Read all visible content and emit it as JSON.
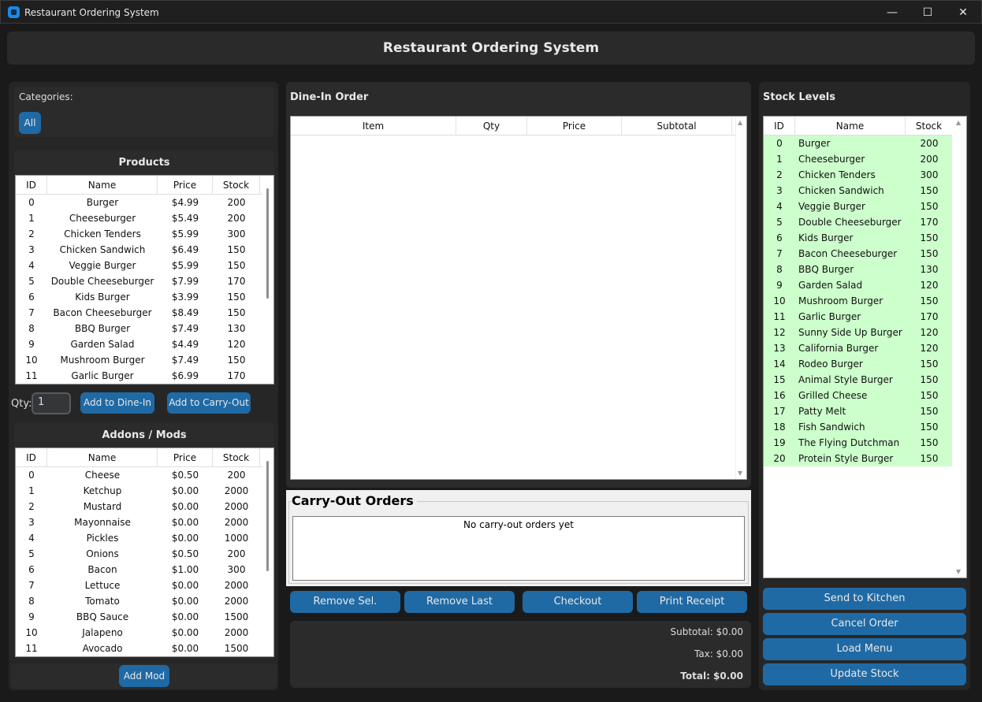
{
  "window": {
    "title": "Restaurant Ordering System",
    "minimize": "—",
    "maximize": "☐",
    "close": "✕"
  },
  "header": {
    "title": "Restaurant Ordering System"
  },
  "categories": {
    "label": "Categories:",
    "buttons": [
      "All"
    ]
  },
  "products": {
    "title": "Products",
    "columns": [
      "ID",
      "Name",
      "Price",
      "Stock"
    ],
    "rows": [
      [
        "0",
        "Burger",
        "$4.99",
        "200"
      ],
      [
        "1",
        "Cheeseburger",
        "$5.49",
        "200"
      ],
      [
        "2",
        "Chicken Tenders",
        "$5.99",
        "300"
      ],
      [
        "3",
        "Chicken Sandwich",
        "$6.49",
        "150"
      ],
      [
        "4",
        "Veggie Burger",
        "$5.99",
        "150"
      ],
      [
        "5",
        "Double Cheeseburger",
        "$7.99",
        "170"
      ],
      [
        "6",
        "Kids Burger",
        "$3.99",
        "150"
      ],
      [
        "7",
        "Bacon Cheeseburger",
        "$8.49",
        "150"
      ],
      [
        "8",
        "BBQ Burger",
        "$7.49",
        "130"
      ],
      [
        "9",
        "Garden Salad",
        "$4.49",
        "120"
      ],
      [
        "10",
        "Mushroom Burger",
        "$7.49",
        "150"
      ],
      [
        "11",
        "Garlic Burger",
        "$6.99",
        "170"
      ]
    ]
  },
  "qty": {
    "label": "Qty:",
    "value": "1"
  },
  "actions": {
    "add_dine_in": "Add to Dine-In",
    "add_carry_out": "Add to Carry-Out"
  },
  "addons": {
    "title": "Addons / Mods",
    "columns": [
      "ID",
      "Name",
      "Price",
      "Stock"
    ],
    "rows": [
      [
        "0",
        "Cheese",
        "$0.50",
        "200"
      ],
      [
        "1",
        "Ketchup",
        "$0.00",
        "2000"
      ],
      [
        "2",
        "Mustard",
        "$0.00",
        "2000"
      ],
      [
        "3",
        "Mayonnaise",
        "$0.00",
        "2000"
      ],
      [
        "4",
        "Pickles",
        "$0.00",
        "1000"
      ],
      [
        "5",
        "Onions",
        "$0.50",
        "200"
      ],
      [
        "6",
        "Bacon",
        "$1.00",
        "300"
      ],
      [
        "7",
        "Lettuce",
        "$0.00",
        "2000"
      ],
      [
        "8",
        "Tomato",
        "$0.00",
        "2000"
      ],
      [
        "9",
        "BBQ Sauce",
        "$0.00",
        "1500"
      ],
      [
        "10",
        "Jalapeno",
        "$0.00",
        "2000"
      ],
      [
        "11",
        "Avocado",
        "$0.00",
        "1500"
      ]
    ],
    "add_mod": "Add Mod"
  },
  "dine_in": {
    "title": "Dine-In Order",
    "columns": [
      "Item",
      "Qty",
      "Price",
      "Subtotal"
    ]
  },
  "carry_out": {
    "title": "Carry-Out Orders",
    "empty": "No carry-out orders yet"
  },
  "order_buttons": {
    "remove_sel": "Remove Sel.",
    "remove_last": "Remove Last",
    "checkout": "Checkout",
    "print_receipt": "Print Receipt"
  },
  "totals": {
    "subtotal": "Subtotal: $0.00",
    "tax": "Tax: $0.00",
    "total": "Total: $0.00"
  },
  "stock": {
    "title": "Stock Levels",
    "columns": [
      "ID",
      "Name",
      "Stock"
    ],
    "rows": [
      [
        "0",
        "Burger",
        "200"
      ],
      [
        "1",
        "Cheeseburger",
        "200"
      ],
      [
        "2",
        "Chicken Tenders",
        "300"
      ],
      [
        "3",
        "Chicken Sandwich",
        "150"
      ],
      [
        "4",
        "Veggie Burger",
        "150"
      ],
      [
        "5",
        "Double Cheeseburger",
        "170"
      ],
      [
        "6",
        "Kids Burger",
        "150"
      ],
      [
        "7",
        "Bacon Cheeseburger",
        "150"
      ],
      [
        "8",
        "BBQ Burger",
        "130"
      ],
      [
        "9",
        "Garden Salad",
        "120"
      ],
      [
        "10",
        "Mushroom Burger",
        "150"
      ],
      [
        "11",
        "Garlic Burger",
        "170"
      ],
      [
        "12",
        "Sunny Side Up Burger",
        "120"
      ],
      [
        "13",
        "California Burger",
        "120"
      ],
      [
        "14",
        "Rodeo Burger",
        "150"
      ],
      [
        "15",
        "Animal Style Burger",
        "150"
      ],
      [
        "16",
        "Grilled Cheese",
        "150"
      ],
      [
        "17",
        "Patty Melt",
        "150"
      ],
      [
        "18",
        "Fish Sandwich",
        "150"
      ],
      [
        "19",
        "The Flying Dutchman",
        "150"
      ],
      [
        "20",
        "Protein Style Burger",
        "150"
      ]
    ]
  },
  "side_buttons": {
    "send_kitchen": "Send to Kitchen",
    "cancel_order": "Cancel Order",
    "load_menu": "Load Menu",
    "update_stock": "Update Stock"
  },
  "colors": {
    "accent": "#1f6aa5",
    "stock_row": "#ccffcc",
    "background": "#1a1a1a"
  }
}
